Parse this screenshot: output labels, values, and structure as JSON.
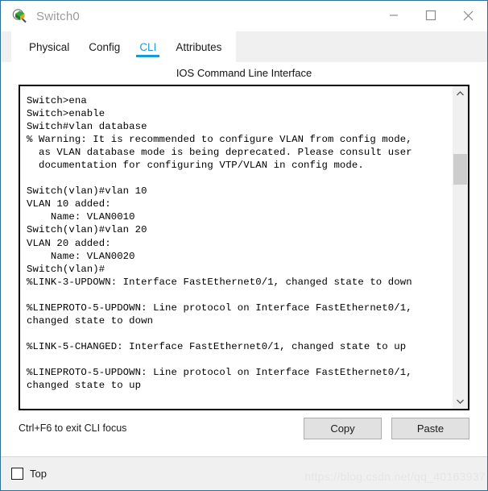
{
  "window": {
    "title": "Switch0",
    "icon": "switch-magnifier-icon",
    "border_color": "#2e7195",
    "controls": {
      "minimize": "minimize-icon",
      "maximize": "maximize-icon",
      "close": "close-icon"
    }
  },
  "tabs": [
    {
      "label": "Physical",
      "active": false
    },
    {
      "label": "Config",
      "active": false
    },
    {
      "label": "CLI",
      "active": true
    },
    {
      "label": "Attributes",
      "active": false
    }
  ],
  "accent_color": "#1b9ad6",
  "panel": {
    "title": "IOS Command Line Interface"
  },
  "terminal": {
    "lines": [
      "Switch>ena",
      "Switch>enable",
      "Switch#vlan database",
      "% Warning: It is recommended to configure VLAN from config mode,",
      "  as VLAN database mode is being deprecated. Please consult user",
      "  documentation for configuring VTP/VLAN in config mode.",
      "",
      "Switch(vlan)#vlan 10",
      "VLAN 10 added:",
      "    Name: VLAN0010",
      "Switch(vlan)#vlan 20",
      "VLAN 20 added:",
      "    Name: VLAN0020",
      "Switch(vlan)#",
      "%LINK-3-UPDOWN: Interface FastEthernet0/1, changed state to down",
      "",
      "%LINEPROTO-5-UPDOWN: Line protocol on Interface FastEthernet0/1,",
      "changed state to down",
      "",
      "%LINK-5-CHANGED: Interface FastEthernet0/1, changed state to up",
      "",
      "%LINEPROTO-5-UPDOWN: Line protocol on Interface FastEthernet0/1,",
      "changed state to up"
    ]
  },
  "scrollbar": {
    "up_arrow": "chevron-up-icon",
    "down_arrow": "chevron-down-icon"
  },
  "footer": {
    "hint": "Ctrl+F6 to exit CLI focus",
    "copy_label": "Copy",
    "paste_label": "Paste"
  },
  "bottom": {
    "top_label": "Top",
    "top_checked": false,
    "watermark": "https://blog.csdn.net/qq_40163937"
  }
}
